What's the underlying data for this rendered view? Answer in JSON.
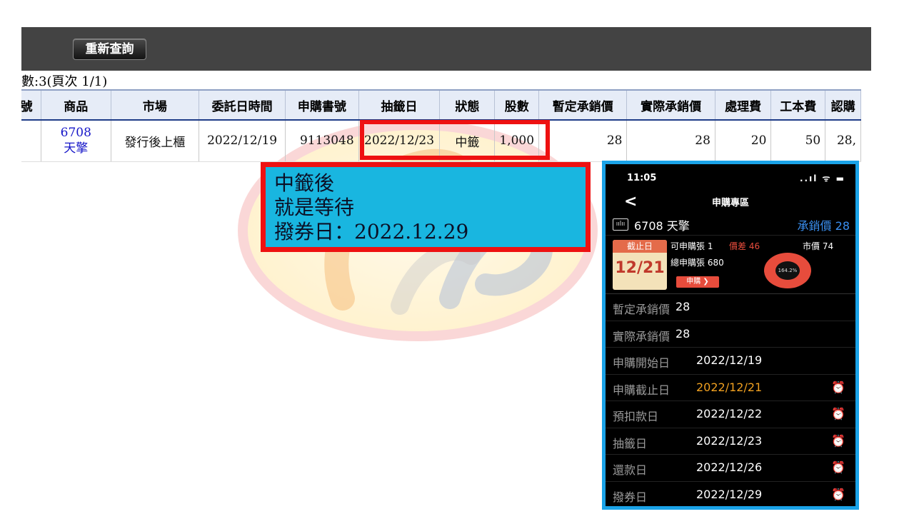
{
  "toolbar": {
    "requery_label": "重新查詢"
  },
  "list": {
    "count_text": "數:3(頁次 1/1)"
  },
  "table": {
    "headers": [
      "號",
      "商品",
      "市場",
      "委託日時間",
      "申購書號",
      "抽籤日",
      "狀態",
      "股數",
      "暫定承銷價",
      "實際承銷價",
      "處理費",
      "工本費",
      "認購"
    ],
    "row": {
      "no": "",
      "product_code": "6708",
      "product_name": "天擎",
      "market": "發行後上櫃",
      "order_date": "2022/12/19",
      "application_no": "9113048",
      "draw_date": "2022/12/23",
      "status": "中籤",
      "shares": "1,000",
      "provisional_price": "28",
      "actual_price": "28",
      "processing_fee": "20",
      "material_fee": "50",
      "subscription_amount": "28,"
    }
  },
  "note": {
    "line1": "中籤後",
    "line2": "就是等待",
    "line3": "撥券日：2022.12.29"
  },
  "phone": {
    "time": "11:05",
    "status_icons": "..ıl ᯤ ▬",
    "back_label": "<",
    "title": "申購專區",
    "chart_icon_glyph": "ıılıı",
    "stock_name": "6708 天擎",
    "underwriting_price": "承銷價 28",
    "calendar_head": "截止日",
    "calendar_date": "12/21",
    "available_lots": "可申購張 1",
    "price_diff": "價差 46",
    "market_price": "市價 74",
    "total_lots": "總申購張 680",
    "apply_label": "申購 ❯",
    "gauge_text": "164.2%",
    "rows": [
      {
        "label": "暫定承銷價",
        "value": "28"
      },
      {
        "label": "實際承銷價",
        "value": "28"
      },
      {
        "label": "申購開始日",
        "value": "2022/12/19"
      },
      {
        "label": "申購截止日",
        "value": "2022/12/21"
      },
      {
        "label": "預扣款日",
        "value": "2022/12/22"
      },
      {
        "label": "抽籤日",
        "value": "2022/12/23"
      },
      {
        "label": "還款日",
        "value": "2022/12/26"
      },
      {
        "label": "撥券日",
        "value": "2022/12/29"
      }
    ],
    "alarm_glyph": "⏰"
  },
  "colors": {
    "topbar": "#434343",
    "highlight_red": "#ee1111",
    "note_bg": "#19b6e0",
    "phone_border": "#1aa3e8",
    "link_blue": "#1515c8",
    "deadline_orange": "#f0a020"
  }
}
